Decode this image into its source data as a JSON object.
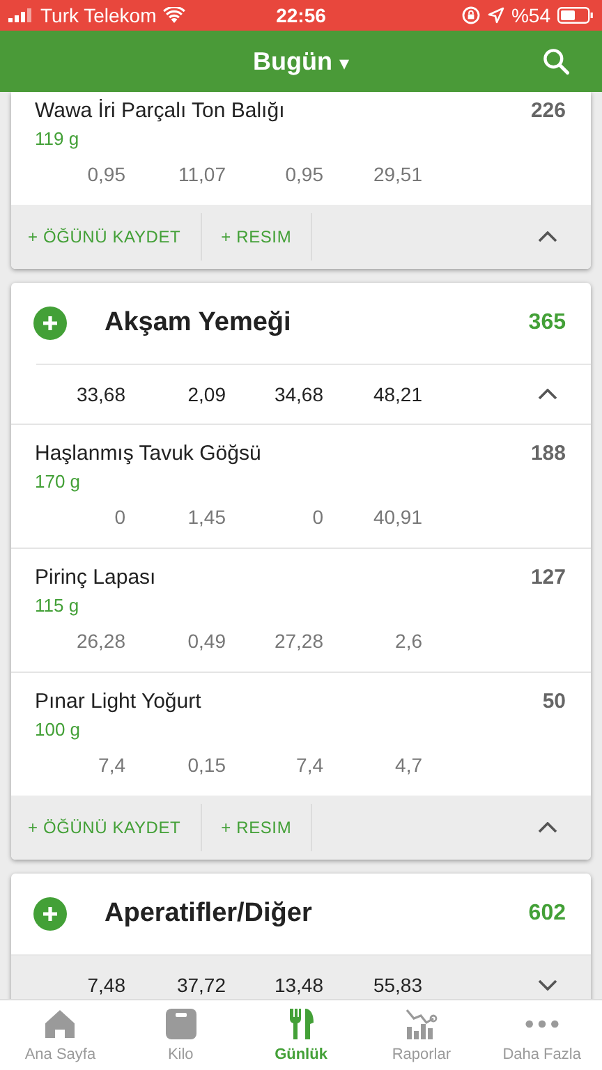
{
  "status_bar": {
    "carrier": "Turk Telekom",
    "time": "22:56",
    "battery": "%54"
  },
  "header": {
    "title": "Bugün",
    "dropdown_caret": "▾"
  },
  "meals": [
    {
      "foods": [
        {
          "name": "Wawa İri Parçalı Ton Balığı",
          "amount": "119 g",
          "calories": "226",
          "macros": [
            "0,95",
            "11,07",
            "0,95",
            "29,51"
          ]
        }
      ],
      "actions": [
        "+ ÖĞÜNÜ KAYDET",
        "+ RESIM"
      ]
    },
    {
      "name": "Akşam Yemeği",
      "calories": "365",
      "summary": {
        "macros": [
          "33,68",
          "2,09",
          "34,68",
          "48,21"
        ],
        "expanded": true
      },
      "foods": [
        {
          "name": "Haşlanmış Tavuk Göğsü",
          "amount": "170 g",
          "calories": "188",
          "macros": [
            "0",
            "1,45",
            "0",
            "40,91"
          ]
        },
        {
          "name": "Pirinç Lapası",
          "amount": "115 g",
          "calories": "127",
          "macros": [
            "26,28",
            "0,49",
            "27,28",
            "2,6"
          ]
        },
        {
          "name": "Pınar Light Yoğurt",
          "amount": "100 g",
          "calories": "50",
          "macros": [
            "7,4",
            "0,15",
            "7,4",
            "4,7"
          ]
        }
      ],
      "actions": [
        "+ ÖĞÜNÜ KAYDET",
        "+ RESIM"
      ]
    },
    {
      "name": "Aperatifler/Diğer",
      "calories": "602",
      "summary": {
        "macros": [
          "7,48",
          "37,72",
          "13,48",
          "55,83"
        ],
        "expanded": false
      }
    }
  ],
  "tabs": [
    {
      "label": "Ana Sayfa",
      "kind": "home",
      "selected": false
    },
    {
      "label": "Kilo",
      "kind": "scale",
      "selected": false
    },
    {
      "label": "Günlük",
      "kind": "diary",
      "selected": true
    },
    {
      "label": "Raporlar",
      "kind": "reports",
      "selected": false
    },
    {
      "label": "Daha Fazla",
      "kind": "more",
      "selected": false
    }
  ]
}
